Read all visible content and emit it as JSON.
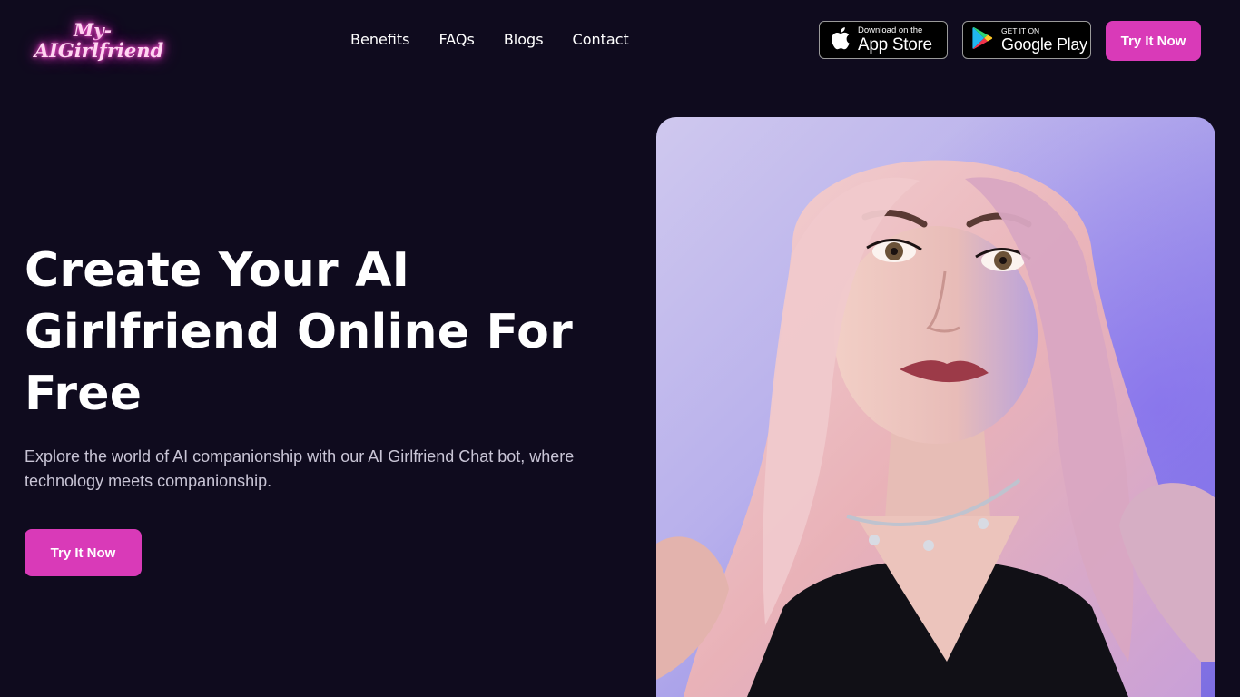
{
  "header": {
    "logo": {
      "line1": "My-",
      "line2": "AIGirlfriend"
    },
    "nav": [
      "Benefits",
      "FAQs",
      "Blogs",
      "Contact"
    ],
    "app_store": {
      "small": "Download on the",
      "big": "App Store"
    },
    "google_play": {
      "small": "GET IT ON",
      "big": "Google Play"
    },
    "cta_label": "Try It Now"
  },
  "hero": {
    "title": "Create Your AI Girlfriend Online For Free",
    "subtitle": "Explore the world of AI companionship with our AI Girlfriend Chat bot, where technology meets companionship.",
    "cta_label": "Try It Now"
  },
  "colors": {
    "background": "#0f0b1e",
    "accent": "#d93ab8",
    "logo_glow": "#e23bc4"
  },
  "icons": [
    "apple-icon",
    "google-play-icon"
  ]
}
